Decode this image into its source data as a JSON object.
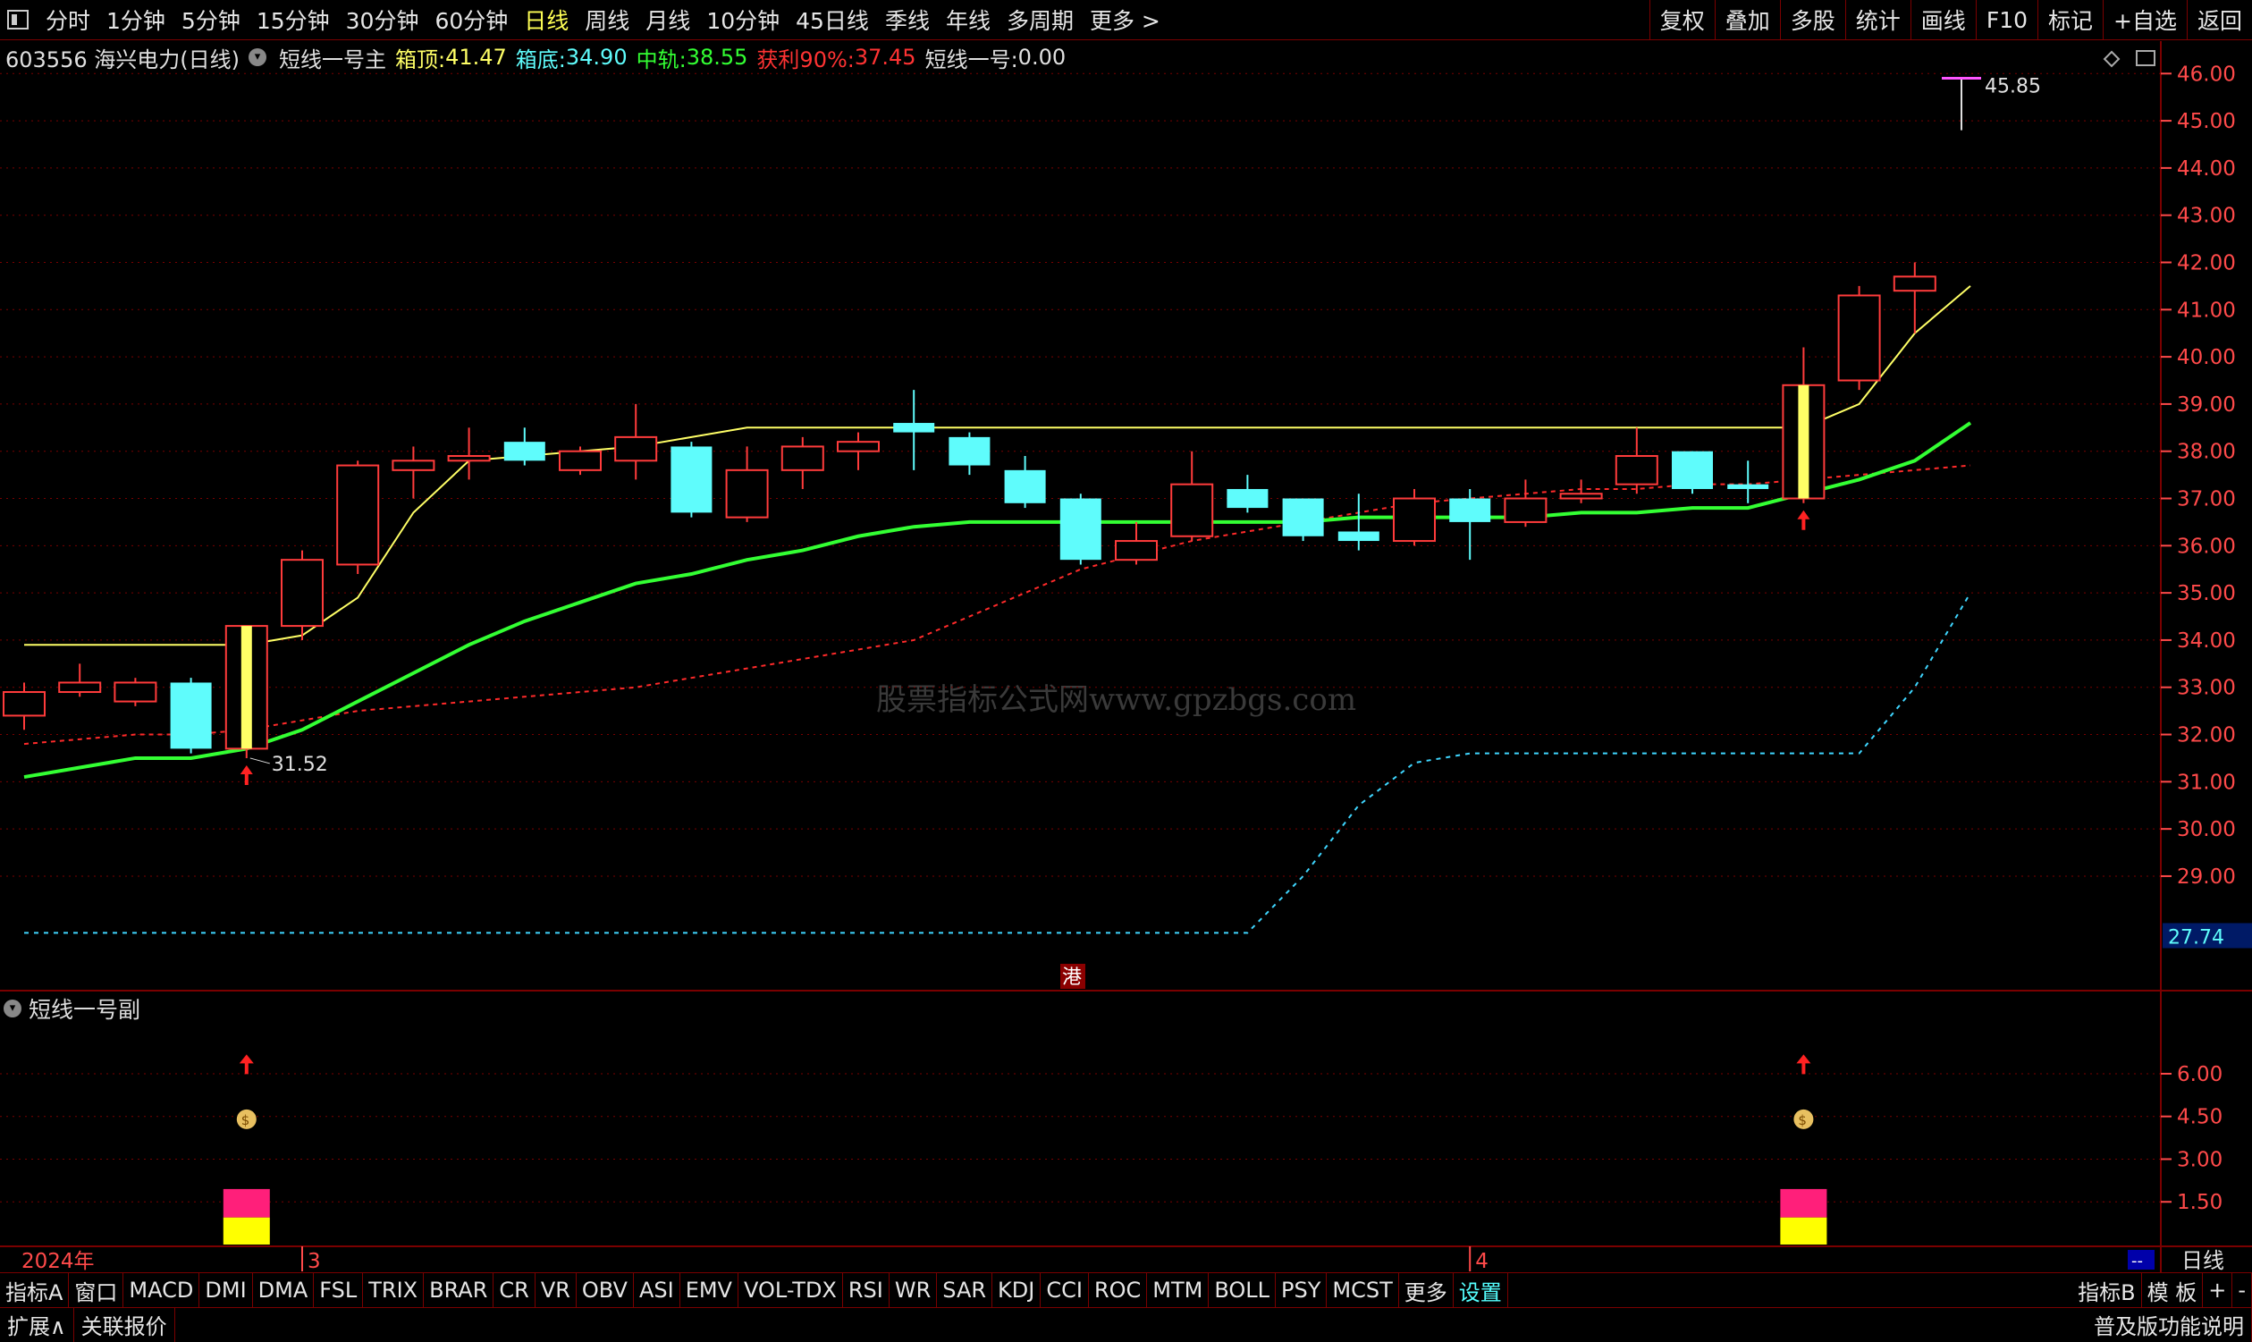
{
  "topbar": {
    "periods": [
      "分时",
      "1分钟",
      "5分钟",
      "15分钟",
      "30分钟",
      "60分钟",
      "日线",
      "周线",
      "月线",
      "10分钟",
      "45日线",
      "季线",
      "年线",
      "多周期",
      "更多 >"
    ],
    "active_period": "日线",
    "right_buttons": [
      "复权",
      "叠加",
      "多股",
      "统计",
      "画线",
      "F10",
      "标记",
      "+自选",
      "返回"
    ]
  },
  "info": {
    "code_name": "603556 海兴电力(日线)",
    "indicator": "短线一号主",
    "box_top_label": "箱顶:",
    "box_top_value": "41.47",
    "box_bottom_label": "箱底:",
    "box_bottom_value": "34.90",
    "mid_label": "中轨:",
    "mid_value": "38.55",
    "profit_label": "获利90%:",
    "profit_value": "37.45",
    "short_label": "短线一号:",
    "short_value": "0.00"
  },
  "colors": {
    "up": "#ff3b3b",
    "down": "#5ffcfc",
    "box": "#ffff66",
    "mid": "#33ff33",
    "profit": "#ff2a2a",
    "lower": "#3fd6ff",
    "axis": "#ff4a4a",
    "grid": "#7a0000"
  },
  "chart_data": {
    "type": "candlestick",
    "y_ticks": [
      "46.00",
      "45.00",
      "44.00",
      "43.00",
      "42.00",
      "41.00",
      "40.00",
      "39.00",
      "38.00",
      "37.00",
      "36.00",
      "35.00",
      "34.00",
      "33.00",
      "32.00",
      "31.00",
      "30.00",
      "29.00"
    ],
    "y_range": [
      27.2,
      46.1
    ],
    "current_price_label": "27.74",
    "high_label": "45.85",
    "low_label": "31.52",
    "x_labels": [
      {
        "text": "2024年",
        "index": 0
      },
      {
        "text": "3",
        "index": 5
      },
      {
        "text": "4",
        "index": 26
      }
    ],
    "candles": [
      {
        "o": 32.4,
        "c": 32.9,
        "h": 33.1,
        "l": 32.1
      },
      {
        "o": 32.9,
        "c": 33.1,
        "h": 33.5,
        "l": 32.8
      },
      {
        "o": 32.7,
        "c": 33.1,
        "h": 33.2,
        "l": 32.6
      },
      {
        "o": 33.1,
        "c": 31.7,
        "h": 33.2,
        "l": 31.6
      },
      {
        "o": 31.7,
        "c": 34.3,
        "h": 34.3,
        "l": 31.5
      },
      {
        "o": 34.3,
        "c": 35.7,
        "h": 35.9,
        "l": 34.0
      },
      {
        "o": 35.6,
        "c": 37.7,
        "h": 37.8,
        "l": 35.4
      },
      {
        "o": 37.6,
        "c": 37.8,
        "h": 38.1,
        "l": 37.0
      },
      {
        "o": 37.8,
        "c": 37.9,
        "h": 38.5,
        "l": 37.4
      },
      {
        "o": 38.2,
        "c": 37.8,
        "h": 38.5,
        "l": 37.7
      },
      {
        "o": 37.6,
        "c": 38.0,
        "h": 38.1,
        "l": 37.5
      },
      {
        "o": 37.8,
        "c": 38.3,
        "h": 39.0,
        "l": 37.4
      },
      {
        "o": 38.1,
        "c": 36.7,
        "h": 38.2,
        "l": 36.6
      },
      {
        "o": 36.6,
        "c": 37.6,
        "h": 38.1,
        "l": 36.5
      },
      {
        "o": 37.6,
        "c": 38.1,
        "h": 38.3,
        "l": 37.2
      },
      {
        "o": 38.0,
        "c": 38.2,
        "h": 38.4,
        "l": 37.6
      },
      {
        "o": 38.6,
        "c": 38.4,
        "h": 39.3,
        "l": 37.6
      },
      {
        "o": 38.3,
        "c": 37.7,
        "h": 38.4,
        "l": 37.5
      },
      {
        "o": 37.6,
        "c": 36.9,
        "h": 37.9,
        "l": 36.8
      },
      {
        "o": 37.0,
        "c": 35.7,
        "h": 37.1,
        "l": 35.6
      },
      {
        "o": 35.7,
        "c": 36.1,
        "h": 36.5,
        "l": 35.6
      },
      {
        "o": 36.2,
        "c": 37.3,
        "h": 38.0,
        "l": 36.1
      },
      {
        "o": 37.2,
        "c": 36.8,
        "h": 37.5,
        "l": 36.7
      },
      {
        "o": 37.0,
        "c": 36.2,
        "h": 37.0,
        "l": 36.1
      },
      {
        "o": 36.3,
        "c": 36.1,
        "h": 37.1,
        "l": 35.9
      },
      {
        "o": 36.1,
        "c": 37.0,
        "h": 37.2,
        "l": 36.0
      },
      {
        "o": 37.0,
        "c": 36.5,
        "h": 37.2,
        "l": 35.7
      },
      {
        "o": 36.5,
        "c": 37.0,
        "h": 37.4,
        "l": 36.4
      },
      {
        "o": 37.0,
        "c": 37.1,
        "h": 37.4,
        "l": 36.9
      },
      {
        "o": 37.3,
        "c": 37.9,
        "h": 38.5,
        "l": 37.1
      },
      {
        "o": 38.0,
        "c": 37.2,
        "h": 38.0,
        "l": 37.1
      },
      {
        "o": 37.3,
        "c": 37.2,
        "h": 37.8,
        "l": 36.9
      },
      {
        "o": 37.0,
        "c": 39.4,
        "h": 40.2,
        "l": 36.9
      },
      {
        "o": 39.5,
        "c": 41.3,
        "h": 41.5,
        "l": 39.3
      },
      {
        "o": 41.4,
        "c": 41.7,
        "h": 42.0,
        "l": 40.5
      },
      {
        "o": 45.8,
        "c": 45.8,
        "h": 45.9,
        "l": 44.8
      }
    ],
    "yellow_bar_indices": [
      4,
      32
    ],
    "lines": {
      "box": [
        33.9,
        33.9,
        33.9,
        33.9,
        33.9,
        34.1,
        34.9,
        36.7,
        37.8,
        37.9,
        38.0,
        38.1,
        38.3,
        38.5,
        38.5,
        38.5,
        38.5,
        38.5,
        38.5,
        38.5,
        38.5,
        38.5,
        38.5,
        38.5,
        38.5,
        38.5,
        38.5,
        38.5,
        38.5,
        38.5,
        38.5,
        38.5,
        38.5,
        39.0,
        40.5,
        41.5
      ],
      "mid": [
        31.1,
        31.3,
        31.5,
        31.5,
        31.7,
        32.1,
        32.7,
        33.3,
        33.9,
        34.4,
        34.8,
        35.2,
        35.4,
        35.7,
        35.9,
        36.2,
        36.4,
        36.5,
        36.5,
        36.5,
        36.5,
        36.5,
        36.5,
        36.5,
        36.6,
        36.6,
        36.6,
        36.6,
        36.7,
        36.7,
        36.8,
        36.8,
        37.1,
        37.4,
        37.8,
        38.6
      ],
      "profit": [
        31.8,
        31.9,
        32.0,
        32.0,
        32.1,
        32.3,
        32.5,
        32.6,
        32.7,
        32.8,
        32.9,
        33.0,
        33.2,
        33.4,
        33.6,
        33.8,
        34.0,
        34.5,
        35.0,
        35.5,
        35.8,
        36.1,
        36.3,
        36.5,
        36.7,
        36.9,
        37.0,
        37.1,
        37.2,
        37.2,
        37.3,
        37.3,
        37.4,
        37.5,
        37.6,
        37.7
      ],
      "lower": [
        27.8,
        27.8,
        27.8,
        27.8,
        27.8,
        27.8,
        27.8,
        27.8,
        27.8,
        27.8,
        27.8,
        27.8,
        27.8,
        27.8,
        27.8,
        27.8,
        27.8,
        27.8,
        27.8,
        27.8,
        27.8,
        27.8,
        27.8,
        29.0,
        30.5,
        31.4,
        31.6,
        31.6,
        31.6,
        31.6,
        31.6,
        31.6,
        31.6,
        31.6,
        33.0,
        35.0
      ]
    },
    "arrow_indices": [
      4,
      32
    ],
    "sub": {
      "title": "短线一号副",
      "y_ticks": [
        "6.00",
        "4.50",
        "3.00",
        "1.50"
      ],
      "y_range": [
        0,
        7.6
      ],
      "bar_indices": [
        4,
        32
      ]
    }
  },
  "port_label": "港",
  "watermark": "股票指标公式网www.gpzbgs.com",
  "bottombar": {
    "tabs": [
      "指标A",
      "窗口",
      "MACD",
      "DMI",
      "DMA",
      "FSL",
      "TRIX",
      "BRAR",
      "CR",
      "VR",
      "OBV",
      "ASI",
      "EMV",
      "VOL-TDX",
      "RSI",
      "WR",
      "SAR",
      "KDJ",
      "CCI",
      "ROC",
      "MTM",
      "BOLL",
      "PSY",
      "MCST",
      "更多",
      "设置"
    ],
    "active_tab": "设置",
    "right_tabs": [
      "指标B",
      "模 板",
      "+",
      "-"
    ],
    "period_label": "日线",
    "row2_left": [
      "扩展∧",
      "关联报价"
    ],
    "row2_right": "普及版功能说明"
  }
}
